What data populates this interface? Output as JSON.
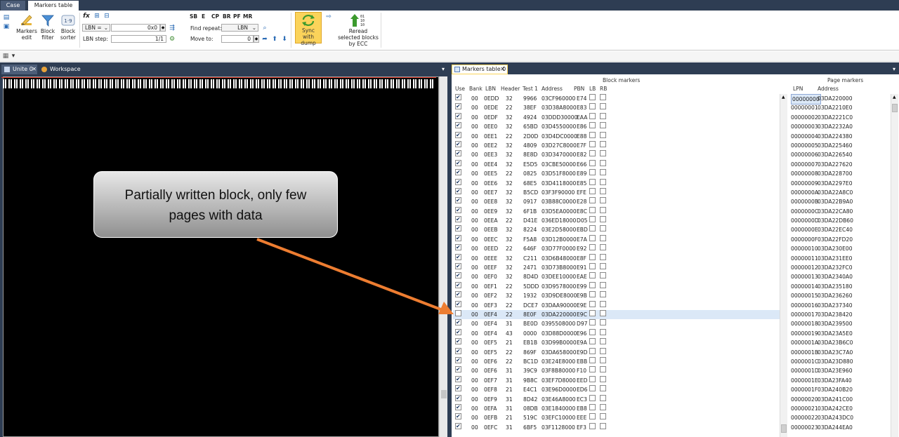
{
  "tabs": [
    "Case",
    "Markers table"
  ],
  "ribbon": {
    "markers_edit": "Markers edit",
    "block_filter": "Block filter",
    "block_sorter": "Block sorter",
    "lbn_combo": "LBN =",
    "lbn_value": "0x0",
    "lbn_step_label": "LBN step:",
    "lbn_step_value": "1/1",
    "find_repeat_label": "Find repeat:",
    "find_repeat_combo": "LBN",
    "move_to_label": "Move to:",
    "move_to_value": "0",
    "flags": [
      "SB",
      "E",
      "CP",
      "BR",
      "PF",
      "MR"
    ],
    "sync_with_dump": "Sync with dump",
    "reread_blocks": "Reread selected blocks by ECC"
  },
  "left_pane": {
    "tab_unite": "Unite 0",
    "tab_workspace": "Workspace"
  },
  "callout": {
    "text_line1": "Partially written block, only few",
    "text_line2": "pages with data"
  },
  "right_pane": {
    "tab": "Markers table 0",
    "block_markers_title": "Block markers",
    "page_markers_title": "Page markers",
    "block_headers": [
      "Use",
      "Bank",
      "LBN",
      "Header",
      "Test 1",
      "Address",
      "PBN",
      "LB",
      "RB"
    ],
    "page_headers": [
      "LPN",
      "Address"
    ],
    "block_rows": [
      {
        "use": true,
        "bank": "00",
        "lbn": "0EDD",
        "header": "32",
        "test1": "9966",
        "address": "03CF960000",
        "pbn": "E74"
      },
      {
        "use": true,
        "bank": "00",
        "lbn": "0EDE",
        "header": "22",
        "test1": "38EF",
        "address": "03D38A8000",
        "pbn": "E83"
      },
      {
        "use": true,
        "bank": "00",
        "lbn": "0EDF",
        "header": "32",
        "test1": "4924",
        "address": "03DDD30000",
        "pbn": "EAA"
      },
      {
        "use": true,
        "bank": "00",
        "lbn": "0EE0",
        "header": "32",
        "test1": "65BD",
        "address": "03D4550000",
        "pbn": "E86"
      },
      {
        "use": true,
        "bank": "00",
        "lbn": "0EE1",
        "header": "22",
        "test1": "2D0D",
        "address": "03D4DC0000",
        "pbn": "E88"
      },
      {
        "use": true,
        "bank": "00",
        "lbn": "0EE2",
        "header": "32",
        "test1": "4809",
        "address": "03D27C8000",
        "pbn": "E7F"
      },
      {
        "use": true,
        "bank": "00",
        "lbn": "0EE3",
        "header": "32",
        "test1": "8E8D",
        "address": "03D3470000",
        "pbn": "E82"
      },
      {
        "use": true,
        "bank": "00",
        "lbn": "0EE4",
        "header": "32",
        "test1": "E5D5",
        "address": "03CBE50000",
        "pbn": "E66"
      },
      {
        "use": true,
        "bank": "00",
        "lbn": "0EE5",
        "header": "22",
        "test1": "0825",
        "address": "03D51F8000",
        "pbn": "E89"
      },
      {
        "use": true,
        "bank": "00",
        "lbn": "0EE6",
        "header": "32",
        "test1": "68E5",
        "address": "03D4118000",
        "pbn": "E85"
      },
      {
        "use": true,
        "bank": "00",
        "lbn": "0EE7",
        "header": "32",
        "test1": "B5CD",
        "address": "03F3F90000",
        "pbn": "EFE"
      },
      {
        "use": true,
        "bank": "00",
        "lbn": "0EE8",
        "header": "32",
        "test1": "0917",
        "address": "03B88C0000",
        "pbn": "E28"
      },
      {
        "use": true,
        "bank": "00",
        "lbn": "0EE9",
        "header": "32",
        "test1": "6F1B",
        "address": "03D5EA0000",
        "pbn": "E8C"
      },
      {
        "use": true,
        "bank": "00",
        "lbn": "0EEA",
        "header": "22",
        "test1": "D41E",
        "address": "036ED18000",
        "pbn": "D05"
      },
      {
        "use": true,
        "bank": "00",
        "lbn": "0EEB",
        "header": "32",
        "test1": "8224",
        "address": "03E2D58000",
        "pbn": "EBD"
      },
      {
        "use": true,
        "bank": "00",
        "lbn": "0EEC",
        "header": "32",
        "test1": "F5A8",
        "address": "03D12B0000",
        "pbn": "E7A"
      },
      {
        "use": true,
        "bank": "00",
        "lbn": "0EED",
        "header": "22",
        "test1": "646F",
        "address": "03D77F0000",
        "pbn": "E92"
      },
      {
        "use": true,
        "bank": "00",
        "lbn": "0EEE",
        "header": "32",
        "test1": "C211",
        "address": "03D6B48000",
        "pbn": "E8F"
      },
      {
        "use": true,
        "bank": "00",
        "lbn": "0EEF",
        "header": "32",
        "test1": "2471",
        "address": "03D73B8000",
        "pbn": "E91"
      },
      {
        "use": true,
        "bank": "00",
        "lbn": "0EF0",
        "header": "32",
        "test1": "8D4D",
        "address": "03DEE10000",
        "pbn": "EAE"
      },
      {
        "use": true,
        "bank": "00",
        "lbn": "0EF1",
        "header": "22",
        "test1": "5DDD",
        "address": "03D9578000",
        "pbn": "E99"
      },
      {
        "use": true,
        "bank": "00",
        "lbn": "0EF2",
        "header": "32",
        "test1": "1932",
        "address": "03D9DE8000",
        "pbn": "E9B"
      },
      {
        "use": true,
        "bank": "00",
        "lbn": "0EF3",
        "header": "22",
        "test1": "DCE7",
        "address": "03DAA90000",
        "pbn": "E9E"
      },
      {
        "use": false,
        "bank": "00",
        "lbn": "0EF4",
        "header": "22",
        "test1": "8E0F",
        "address": "03DA220000",
        "pbn": "E9C",
        "selected": true
      },
      {
        "use": true,
        "bank": "00",
        "lbn": "0EF4",
        "header": "31",
        "test1": "BE0D",
        "address": "0395508000",
        "pbn": "D97"
      },
      {
        "use": true,
        "bank": "00",
        "lbn": "0EF4",
        "header": "43",
        "test1": "0000",
        "address": "03D88D0000",
        "pbn": "E96"
      },
      {
        "use": true,
        "bank": "00",
        "lbn": "0EF5",
        "header": "21",
        "test1": "EB1B",
        "address": "03D99B0000",
        "pbn": "E9A"
      },
      {
        "use": true,
        "bank": "00",
        "lbn": "0EF5",
        "header": "22",
        "test1": "869F",
        "address": "03DA658000",
        "pbn": "E9D"
      },
      {
        "use": true,
        "bank": "00",
        "lbn": "0EF6",
        "header": "22",
        "test1": "BC1D",
        "address": "03E24E8000",
        "pbn": "EBB"
      },
      {
        "use": true,
        "bank": "00",
        "lbn": "0EF6",
        "header": "31",
        "test1": "39C9",
        "address": "03F8B80000",
        "pbn": "F10"
      },
      {
        "use": true,
        "bank": "00",
        "lbn": "0EF7",
        "header": "31",
        "test1": "9B8C",
        "address": "03EF7D8000",
        "pbn": "EED"
      },
      {
        "use": true,
        "bank": "00",
        "lbn": "0EF8",
        "header": "21",
        "test1": "E4C1",
        "address": "03E96D0000",
        "pbn": "ED6"
      },
      {
        "use": true,
        "bank": "00",
        "lbn": "0EF9",
        "header": "31",
        "test1": "8D42",
        "address": "03E46A8000",
        "pbn": "EC3"
      },
      {
        "use": true,
        "bank": "00",
        "lbn": "0EFA",
        "header": "31",
        "test1": "08DB",
        "address": "03E1840000",
        "pbn": "EB8"
      },
      {
        "use": true,
        "bank": "00",
        "lbn": "0EFB",
        "header": "21",
        "test1": "519C",
        "address": "03EFC10000",
        "pbn": "EEE"
      },
      {
        "use": true,
        "bank": "00",
        "lbn": "0EFC",
        "header": "31",
        "test1": "6BF5",
        "address": "03F1128000",
        "pbn": "EF3"
      }
    ],
    "page_rows": [
      {
        "lpn": "00000000",
        "address": "03DA220000"
      },
      {
        "lpn": "00000001",
        "address": "03DA2210E0"
      },
      {
        "lpn": "00000002",
        "address": "03DA2221C0"
      },
      {
        "lpn": "00000003",
        "address": "03DA2232A0"
      },
      {
        "lpn": "00000004",
        "address": "03DA224380"
      },
      {
        "lpn": "00000005",
        "address": "03DA225460"
      },
      {
        "lpn": "00000006",
        "address": "03DA226540"
      },
      {
        "lpn": "00000007",
        "address": "03DA227620"
      },
      {
        "lpn": "00000008",
        "address": "03DA228700"
      },
      {
        "lpn": "00000009",
        "address": "03DA2297E0"
      },
      {
        "lpn": "0000000A",
        "address": "03DA22A8C0"
      },
      {
        "lpn": "0000000B",
        "address": "03DA22B9A0"
      },
      {
        "lpn": "0000000C",
        "address": "03DA22CA80"
      },
      {
        "lpn": "0000000D",
        "address": "03DA22DB60"
      },
      {
        "lpn": "0000000E",
        "address": "03DA22EC40"
      },
      {
        "lpn": "0000000F",
        "address": "03DA22FD20"
      },
      {
        "lpn": "00000010",
        "address": "03DA230E00"
      },
      {
        "lpn": "00000011",
        "address": "03DA231EE0"
      },
      {
        "lpn": "00000012",
        "address": "03DA232FC0"
      },
      {
        "lpn": "00000013",
        "address": "03DA2340A0"
      },
      {
        "lpn": "00000014",
        "address": "03DA235180"
      },
      {
        "lpn": "00000015",
        "address": "03DA236260"
      },
      {
        "lpn": "00000016",
        "address": "03DA237340"
      },
      {
        "lpn": "00000017",
        "address": "03DA238420"
      },
      {
        "lpn": "00000018",
        "address": "03DA239500"
      },
      {
        "lpn": "00000019",
        "address": "03DA23A5E0"
      },
      {
        "lpn": "0000001A",
        "address": "03DA23B6C0"
      },
      {
        "lpn": "0000001B",
        "address": "03DA23C7A0"
      },
      {
        "lpn": "0000001C",
        "address": "03DA23D880"
      },
      {
        "lpn": "0000001D",
        "address": "03DA23E960"
      },
      {
        "lpn": "0000001E",
        "address": "03DA23FA40"
      },
      {
        "lpn": "0000001F",
        "address": "03DA240B20"
      },
      {
        "lpn": "00000020",
        "address": "03DA241C00"
      },
      {
        "lpn": "00000021",
        "address": "03DA242CE0"
      },
      {
        "lpn": "00000022",
        "address": "03DA243DC0"
      },
      {
        "lpn": "00000023",
        "address": "03DA244EA0"
      }
    ]
  }
}
